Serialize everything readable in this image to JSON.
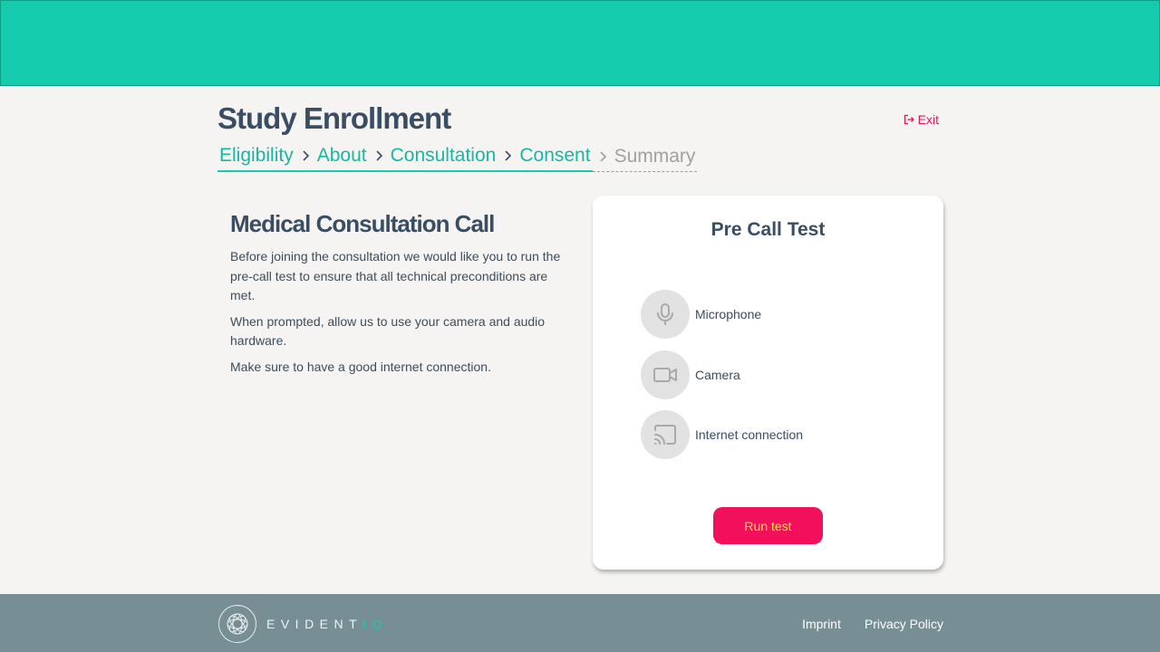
{
  "header": {
    "title": "Study Enrollment",
    "exit_label": "Exit"
  },
  "breadcrumb": {
    "steps": [
      {
        "label": "Eligibility",
        "state": "done"
      },
      {
        "label": "About",
        "state": "done"
      },
      {
        "label": "Consultation",
        "state": "done"
      },
      {
        "label": "Consent",
        "state": "done"
      },
      {
        "label": "Summary",
        "state": "pending"
      }
    ]
  },
  "main": {
    "title": "Medical Consultation Call",
    "paragraphs": [
      "Before joining the consultation we would like you to run the pre-call test to ensure that all technical preconditions are met.",
      "When prompted, allow us to use your camera and audio hardware.",
      "Make sure to have a good internet connection."
    ]
  },
  "precall": {
    "title": "Pre Call Test",
    "items": [
      {
        "label": "Microphone",
        "icon": "microphone-icon"
      },
      {
        "label": "Camera",
        "icon": "camera-icon"
      },
      {
        "label": "Internet connection",
        "icon": "cast-icon"
      }
    ],
    "button_label": "Run test"
  },
  "footer": {
    "brand_main": "EVIDENT",
    "brand_accent": "IQ",
    "links": [
      "Imprint",
      "Privacy Policy"
    ]
  },
  "colors": {
    "accent": "#15cbad",
    "primary_button": "#f2105d",
    "button_text": "#f6e94a",
    "footer_bg": "#788e95",
    "title_text": "#3a4e63"
  }
}
